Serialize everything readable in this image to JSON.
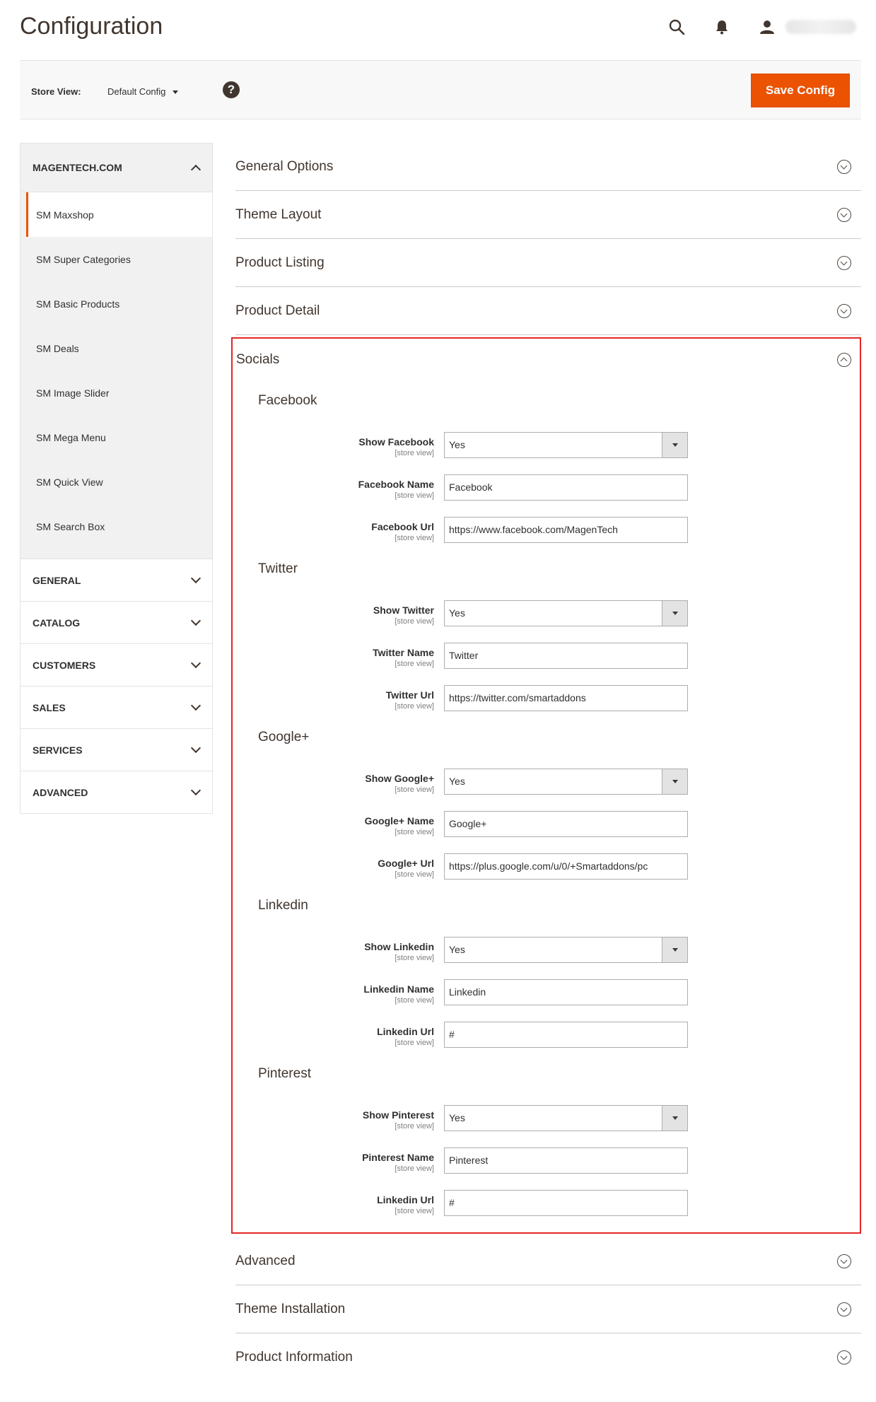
{
  "page": {
    "title": "Configuration"
  },
  "header": {
    "search_icon": "search-icon",
    "bell_icon": "bell-icon",
    "user_icon": "user-icon"
  },
  "toolbar": {
    "store_view_label": "Store View:",
    "store_view_value": "Default Config",
    "help_icon": "?",
    "save_label": "Save Config",
    "save_color": "#eb5202"
  },
  "sidebar": {
    "open_group": "MAGENTECH.COM",
    "items": [
      "SM Maxshop",
      "SM Super Categories",
      "SM Basic Products",
      "SM Deals",
      "SM Image Slider",
      "SM Mega Menu",
      "SM Quick View",
      "SM Search Box"
    ],
    "closed_groups": [
      "GENERAL",
      "CATALOG",
      "CUSTOMERS",
      "SALES",
      "SERVICES",
      "ADVANCED"
    ]
  },
  "sections_top": [
    "General Options",
    "Theme Layout",
    "Product Listing",
    "Product Detail"
  ],
  "socials": {
    "title": "Socials",
    "highlight_color": "#e22626",
    "scope": "[store view]",
    "groups": [
      {
        "title": "Facebook",
        "fields": [
          {
            "label": "Show Facebook",
            "value": "Yes"
          },
          {
            "label": "Facebook Name",
            "value": "Facebook"
          },
          {
            "label": "Facebook Url",
            "value": "https://www.facebook.com/MagenTech"
          }
        ]
      },
      {
        "title": "Twitter",
        "fields": [
          {
            "label": "Show Twitter",
            "value": "Yes"
          },
          {
            "label": "Twitter Name",
            "value": "Twitter"
          },
          {
            "label": "Twitter Url",
            "value": "https://twitter.com/smartaddons"
          }
        ]
      },
      {
        "title": "Google+",
        "fields": [
          {
            "label": "Show Google+",
            "value": "Yes"
          },
          {
            "label": "Google+ Name",
            "value": "Google+"
          },
          {
            "label": "Google+ Url",
            "value": "https://plus.google.com/u/0/+Smartaddons/pc"
          }
        ]
      },
      {
        "title": "Linkedin",
        "fields": [
          {
            "label": "Show Linkedin",
            "value": "Yes"
          },
          {
            "label": "Linkedin Name",
            "value": "Linkedin"
          },
          {
            "label": "Linkedin Url",
            "value": "#"
          }
        ]
      },
      {
        "title": "Pinterest",
        "fields": [
          {
            "label": "Show Pinterest",
            "value": "Yes"
          },
          {
            "label": "Pinterest Name",
            "value": "Pinterest"
          },
          {
            "label": "Linkedin Url",
            "value": "#"
          }
        ]
      }
    ]
  },
  "sections_bottom": [
    "Advanced",
    "Theme Installation",
    "Product Information"
  ]
}
